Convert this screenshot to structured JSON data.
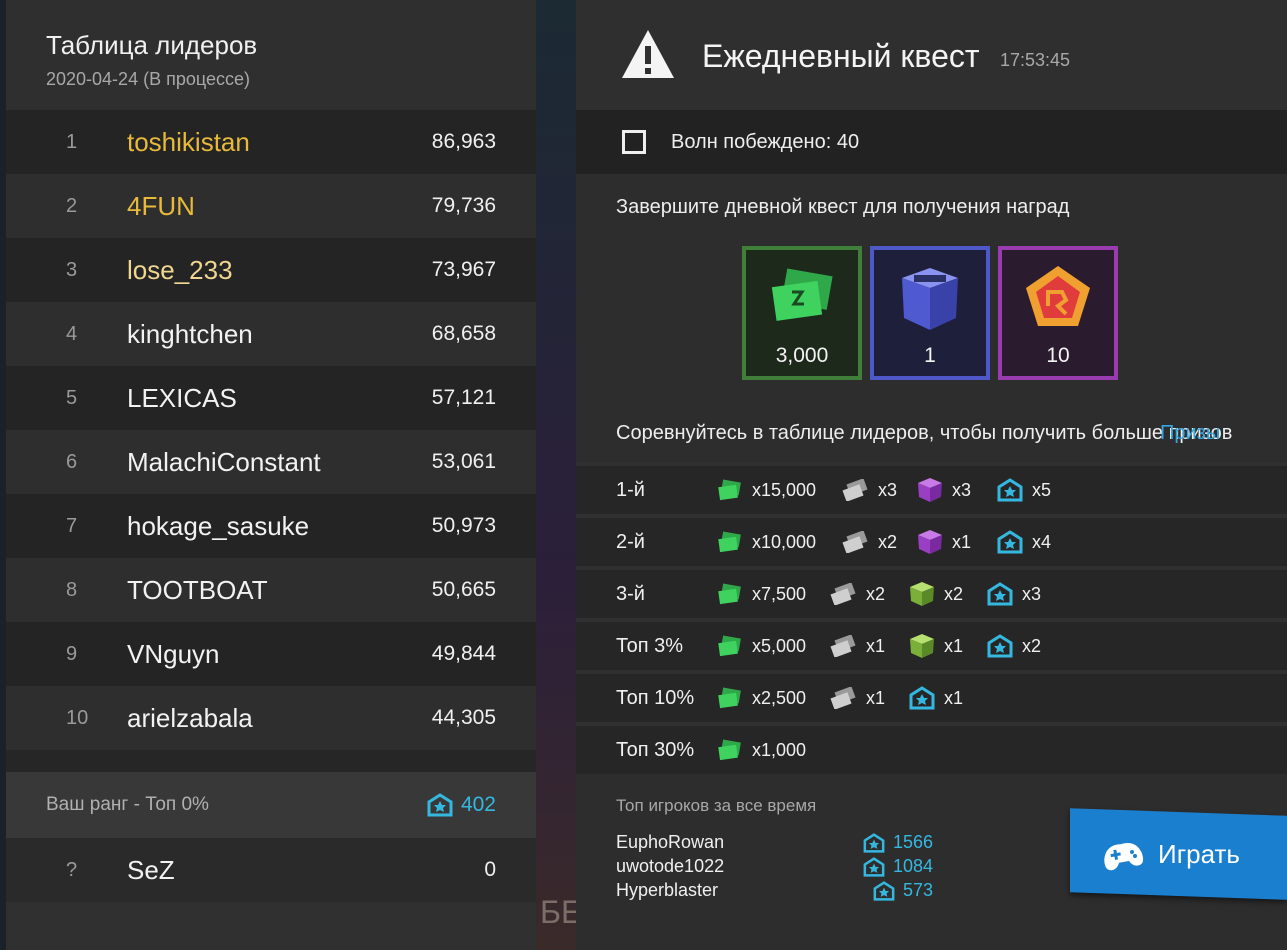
{
  "leaderboard": {
    "title": "Таблица лидеров",
    "subtitle": "2020-04-24 (В процессе)",
    "rows": [
      {
        "rank": "1",
        "name": "toshikistan",
        "score": "86,963"
      },
      {
        "rank": "2",
        "name": "4FUN",
        "score": "79,736"
      },
      {
        "rank": "3",
        "name": "lose_233",
        "score": "73,967"
      },
      {
        "rank": "4",
        "name": "kinghtchen",
        "score": "68,658"
      },
      {
        "rank": "5",
        "name": "LEXICAS",
        "score": "57,121"
      },
      {
        "rank": "6",
        "name": "MalachiConstant",
        "score": "53,061"
      },
      {
        "rank": "7",
        "name": "hokage_sasuke",
        "score": "50,973"
      },
      {
        "rank": "8",
        "name": "TOOTBOAT",
        "score": "50,665"
      },
      {
        "rank": "9",
        "name": "VNguyn",
        "score": "49,844"
      },
      {
        "rank": "10",
        "name": "arielzabala",
        "score": "44,305"
      }
    ],
    "my_rank_label": "Ваш ранг - Топ 0%",
    "my_rank_points": "402",
    "me": {
      "rank": "?",
      "name": "SeZ",
      "score": "0"
    }
  },
  "quest": {
    "title": "Ежедневный квест",
    "time": "17:53:45",
    "objective": "Волн побеждено: 40",
    "description": "Завершите дневной квест для получения наград",
    "rewards": [
      {
        "type": "cash",
        "qty": "3,000"
      },
      {
        "type": "crate",
        "qty": "1"
      },
      {
        "type": "token",
        "qty": "10"
      }
    ],
    "compete_text": "Соревнуйтесь в таблице лидеров, чтобы получить больше призов",
    "prizes_link": "Призы"
  },
  "tiers": [
    {
      "label": "1-й",
      "cash": "x15,000",
      "tickets": "x3",
      "crate": "x3",
      "medal": "x5"
    },
    {
      "label": "2-й",
      "cash": "x10,000",
      "tickets": "x2",
      "crate": "x1",
      "medal": "x4"
    },
    {
      "label": "3-й",
      "cash": "x7,500",
      "tickets": "x2",
      "crate": "x2",
      "medal": "x3"
    },
    {
      "label": "Топ 3%",
      "cash": "x5,000",
      "tickets": "x1",
      "crate": "x1",
      "medal": "x2"
    },
    {
      "label": "Топ 10%",
      "cash": "x2,500",
      "tickets": "x1",
      "medal": "x1"
    },
    {
      "label": "Топ 30%",
      "cash": "x1,000"
    }
  ],
  "all_time": {
    "title": "Топ игроков за все время",
    "players": [
      {
        "name": "EuphoRowan",
        "points": "1566"
      },
      {
        "name": "uwotode1022",
        "points": "1084"
      },
      {
        "name": "Hyperblaster",
        "points": "573"
      }
    ]
  },
  "play_button": "Играть",
  "background_text": "БЕ",
  "colors": {
    "accent": "#1b7fcf",
    "gold": "#e8b93a",
    "points": "#35b8e0"
  }
}
